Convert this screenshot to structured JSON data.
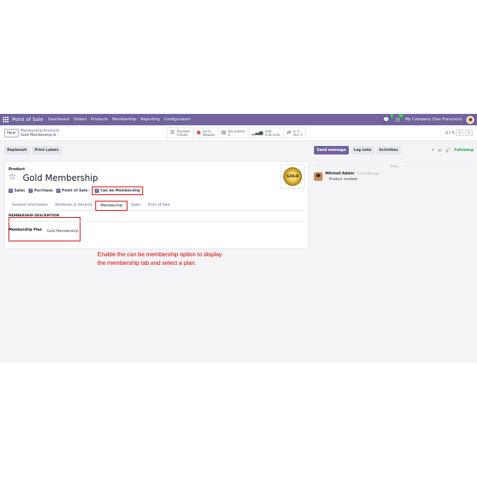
{
  "navbar": {
    "app_name": "Point of Sale",
    "menu": [
      "Dashboard",
      "Orders",
      "Products",
      "Membership",
      "Reporting",
      "Configuration"
    ],
    "chat_badge": "5",
    "activity_badge": "10",
    "company": "My Company (San Francisco)"
  },
  "control_panel": {
    "new_label": "New",
    "breadcrumb_parent": "Membership Products",
    "breadcrumb_current": "Gold Membership",
    "smart_buttons": [
      {
        "icon": "list-icon",
        "line1": "Pricelists",
        "line2": "0 Rules"
      },
      {
        "icon": "globe-icon",
        "line1": "Go to",
        "line2": "Website"
      },
      {
        "icon": "document-icon",
        "line1": "Documents",
        "line2": "0"
      },
      {
        "icon": "bar-chart-icon",
        "line1": "Sold",
        "line2": "0.00 Units"
      },
      {
        "icon": "transfer-icon",
        "line1": "In: 0",
        "line2": "Out: 1"
      }
    ],
    "pager": "2 / 3"
  },
  "actions": {
    "replenish": "Replenish",
    "print_labels": "Print Labels"
  },
  "form": {
    "product_label": "Product",
    "product_name": "Gold Membership",
    "logo_text": "GOLD",
    "checks": {
      "sales": "Sales",
      "purchase": "Purchase",
      "point_of_sale": "Point of Sale",
      "pos_sup": "?",
      "membership": "Can be Membership"
    },
    "tabs": [
      "General Information",
      "Attributes & Variants",
      "Membership",
      "Sales",
      "Point of Sale"
    ],
    "active_tab": "Membership",
    "membership_description": "MEMBERSHIP DESCRIPTION",
    "membership_plan_label": "Membership Plan",
    "membership_plan_value": "Gold Membership"
  },
  "annotation": {
    "line1": "Enable the can be membership option to display",
    "line2": "the membership tab and select a plan."
  },
  "chatter": {
    "send_message": "Send message",
    "log_note": "Log note",
    "activities": "Activities",
    "followers_count": "1",
    "following": "Following",
    "date_separator": "Today",
    "author": "Mitchell Admin",
    "time": "- 13 minutes ago",
    "body": "Product created"
  },
  "colors": {
    "brand": "#71639e",
    "highlight": "#d10000",
    "following": "#28a745"
  }
}
